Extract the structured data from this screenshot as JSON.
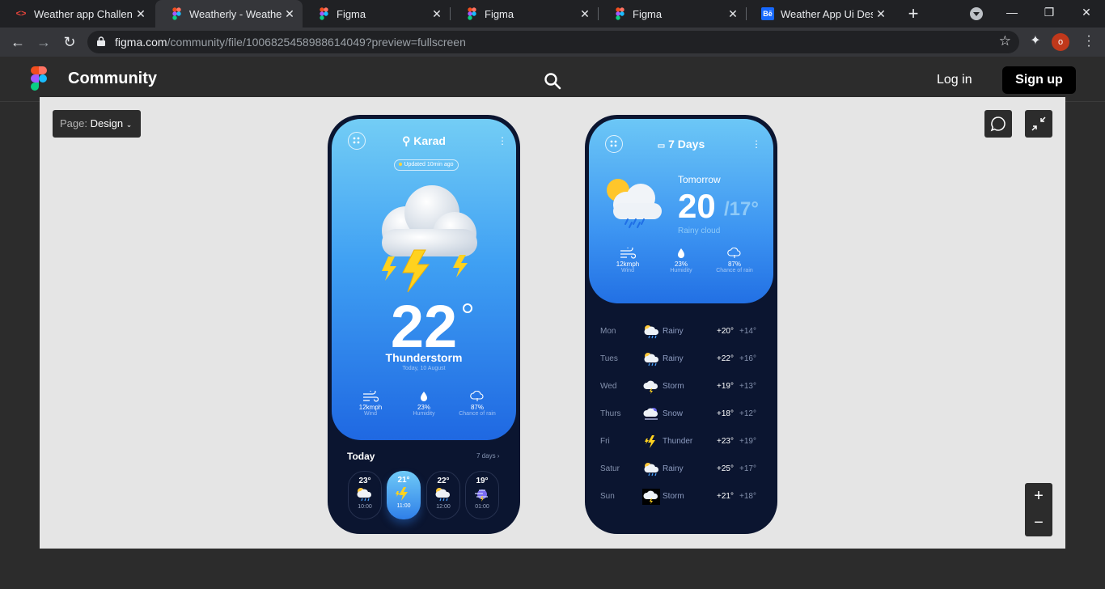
{
  "browser": {
    "tabs": [
      {
        "title": "Weather app Challenge",
        "favicon": "code-brackets-icon"
      },
      {
        "title": "Weatherly - Weather fo",
        "favicon": "figma-icon",
        "active": true
      },
      {
        "title": "Figma",
        "favicon": "figma-icon"
      },
      {
        "title": "Figma",
        "favicon": "figma-icon"
      },
      {
        "title": "Figma",
        "favicon": "figma-icon"
      },
      {
        "title": "Weather App Ui Design",
        "favicon": "behance-icon"
      }
    ],
    "url_host": "figma.com",
    "url_path": "/community/file/1006825458988614049?preview=fullscreen",
    "profile_initial": "o"
  },
  "figma": {
    "section": "Community",
    "login": "Log in",
    "signup": "Sign up",
    "page_prefix": "Page:",
    "page_name": "Design"
  },
  "screen1": {
    "location": "Karad",
    "updated": "Updated 10min ago",
    "temperature": "22",
    "condition": "Thunderstorm",
    "date": "Today, 10 August",
    "stats": [
      {
        "value": "12kmph",
        "label": "Wind"
      },
      {
        "value": "23%",
        "label": "Humidity"
      },
      {
        "value": "87%",
        "label": "Chance of rain"
      }
    ],
    "today_label": "Today",
    "seven_days_link": "7 days",
    "hourly": [
      {
        "temp": "23°",
        "time": "10:00",
        "icon": "rain-cloud-icon"
      },
      {
        "temp": "21°",
        "time": "11:00",
        "icon": "lightning-icon",
        "active": true
      },
      {
        "temp": "22°",
        "time": "12:00",
        "icon": "rain-cloud-icon"
      },
      {
        "temp": "19°",
        "time": "01:00",
        "icon": "night-storm-icon"
      }
    ]
  },
  "screen2": {
    "title": "7 Days",
    "tomorrow_label": "Tomorrow",
    "high": "20",
    "low": "/17°",
    "condition": "Rainy cloud",
    "stats": [
      {
        "value": "12kmph",
        "label": "Wind"
      },
      {
        "value": "23%",
        "label": "Humidity"
      },
      {
        "value": "87%",
        "label": "Chance of rain"
      }
    ],
    "days": [
      {
        "day": "Mon",
        "cond": "Rainy",
        "hi": "+20°",
        "lo": "+14°"
      },
      {
        "day": "Tues",
        "cond": "Rainy",
        "hi": "+22°",
        "lo": "+16°"
      },
      {
        "day": "Wed",
        "cond": "Storm",
        "hi": "+19°",
        "lo": "+13°"
      },
      {
        "day": "Thurs",
        "cond": "Snow",
        "hi": "+18°",
        "lo": "+12°"
      },
      {
        "day": "Fri",
        "cond": "Thunder",
        "hi": "+23°",
        "lo": "+19°"
      },
      {
        "day": "Satur",
        "cond": "Rainy",
        "hi": "+25°",
        "lo": "+17°"
      },
      {
        "day": "Sun",
        "cond": "Storm",
        "hi": "+21°",
        "lo": "+18°"
      }
    ]
  }
}
